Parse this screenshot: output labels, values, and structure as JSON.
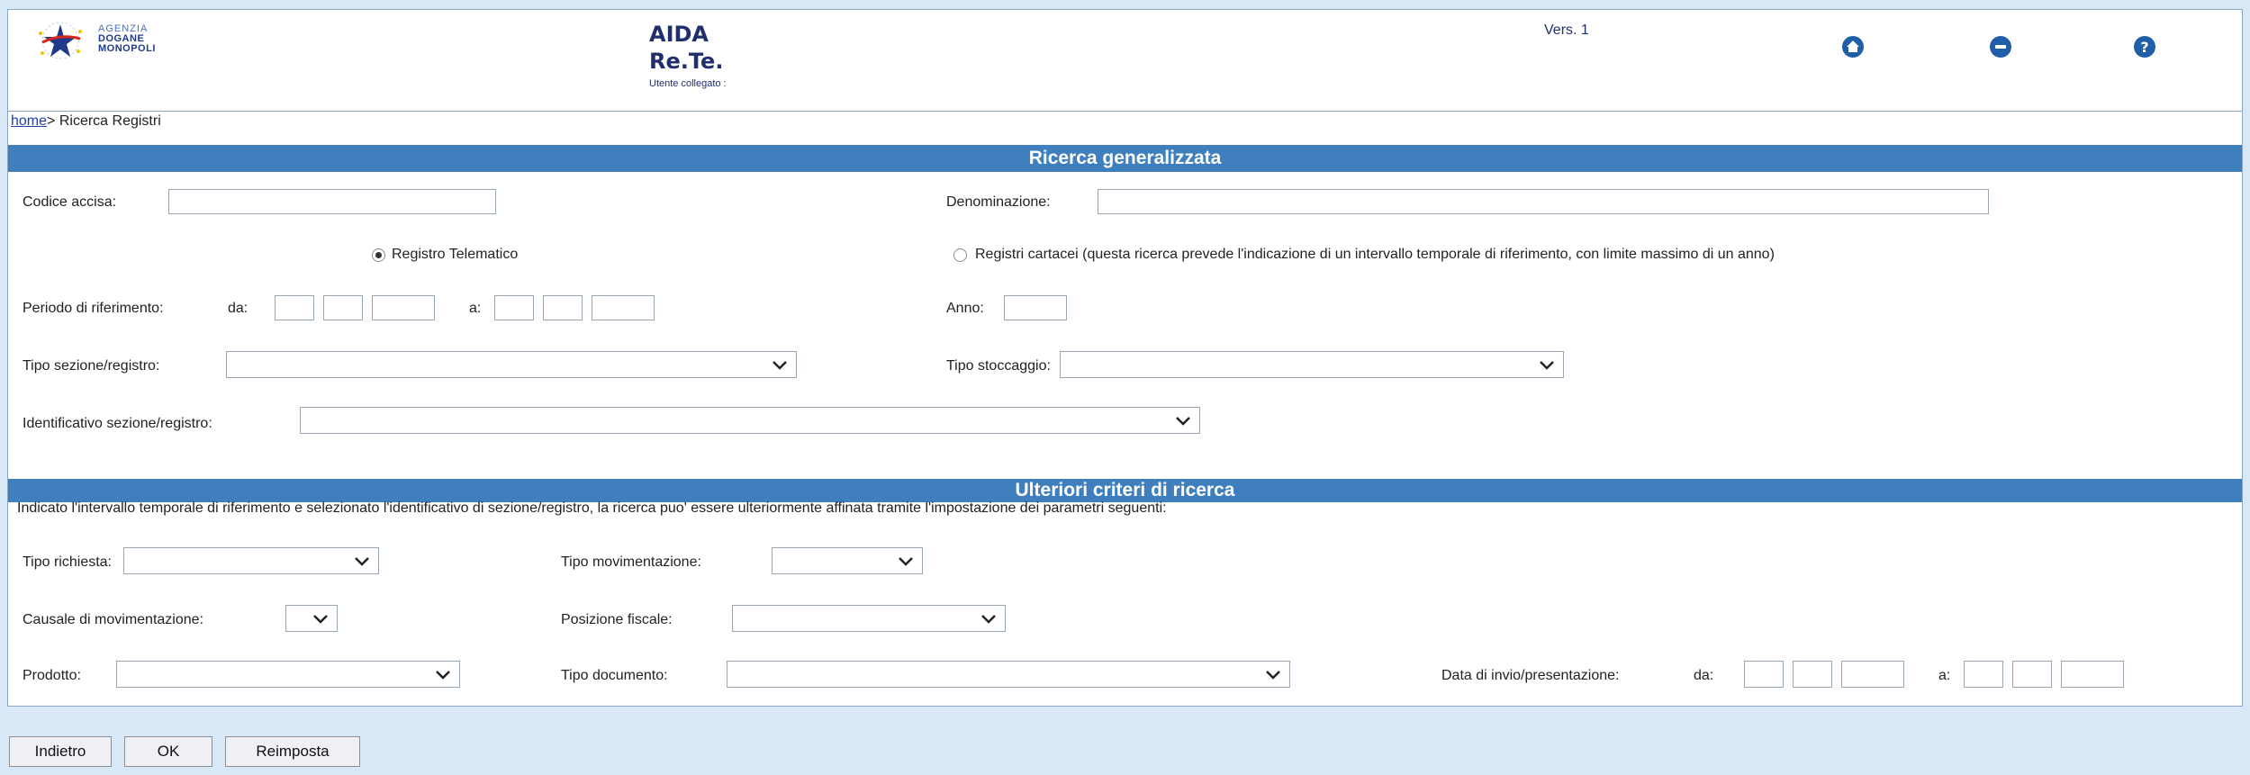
{
  "header": {
    "logo_line1": "AGENZIA",
    "logo_line2": "DOGANE",
    "logo_line3": "MONOPOLI",
    "app_title": "AIDA",
    "app_subtitle": "Re.Te.",
    "user_label": "Utente collegato :",
    "version": "Vers. 1",
    "icons": [
      "home-icon",
      "logout-icon",
      "help-icon"
    ],
    "icon_color": "#1f5fa8"
  },
  "breadcrumb": {
    "home_link": "home",
    "separator": "> ",
    "current": "Ricerca Registri"
  },
  "section1": {
    "title": "Ricerca generalizzata",
    "codice_accisa_label": "Codice accisa:",
    "codice_accisa_value": "",
    "denominazione_label": "Denominazione:",
    "denominazione_value": "",
    "radio_telematico_label": "Registro Telematico",
    "radio_telematico_checked": true,
    "radio_cartacei_label": "Registri cartacei (questa ricerca prevede l'indicazione di un intervallo temporale di riferimento, con limite massimo di un anno)",
    "radio_cartacei_checked": false,
    "periodo_label": "Periodo di riferimento:",
    "da_label": "da:",
    "a_label": "a:",
    "anno_label": "Anno:",
    "tipo_sezione_label": "Tipo sezione/registro:",
    "tipo_sezione_value": "",
    "tipo_stoccaggio_label": "Tipo stoccaggio:",
    "tipo_stoccaggio_value": "",
    "identificativo_label": "Identificativo sezione/registro:",
    "identificativo_value": ""
  },
  "section2": {
    "title": "Ulteriori criteri di ricerca",
    "description": "Indicato l'intervallo temporale di riferimento e selezionato l'identificativo di sezione/registro, la ricerca puo' essere ulteriormente affinata tramite l'impostazione dei parametri seguenti:",
    "tipo_richiesta_label": "Tipo richiesta:",
    "tipo_movimentazione_label": "Tipo movimentazione:",
    "causale_label": "Causale di movimentazione:",
    "posizione_fiscale_label": "Posizione fiscale:",
    "prodotto_label": "Prodotto:",
    "tipo_documento_label": "Tipo documento:",
    "data_invio_label": "Data di invio/presentazione:",
    "da_label": "da:",
    "a_label": "a:"
  },
  "buttons": {
    "back": "Indietro",
    "ok": "OK",
    "reset": "Reimposta"
  },
  "colors": {
    "section_bar": "#3f7fbd",
    "page_bg": "#d9e8f7",
    "link": "#1f3faa"
  }
}
